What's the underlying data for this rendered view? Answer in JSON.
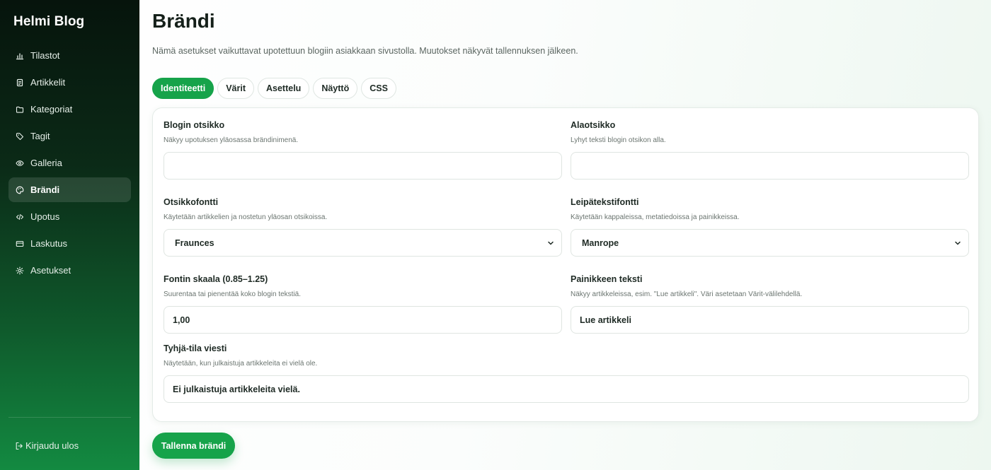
{
  "app": {
    "title": "Helmi Blog"
  },
  "sidebar": {
    "items": [
      {
        "label": "Tilastot",
        "icon": "bar-chart-icon"
      },
      {
        "label": "Artikkelit",
        "icon": "document-icon"
      },
      {
        "label": "Kategoriat",
        "icon": "folder-icon"
      },
      {
        "label": "Tagit",
        "icon": "tag-icon"
      },
      {
        "label": "Galleria",
        "icon": "eye-icon"
      },
      {
        "label": "Brändi",
        "icon": "palette-icon",
        "active": true
      },
      {
        "label": "Upotus",
        "icon": "code-icon"
      },
      {
        "label": "Laskutus",
        "icon": "credit-card-icon"
      },
      {
        "label": "Asetukset",
        "icon": "gear-icon"
      }
    ],
    "logout_label": "Kirjaudu ulos"
  },
  "page": {
    "title": "Brändi",
    "description": "Nämä asetukset vaikuttavat upotettuun blogiin asiakkaan sivustolla. Muutokset näkyvät tallennuksen jälkeen."
  },
  "tabs": [
    {
      "label": "Identiteetti",
      "active": true
    },
    {
      "label": "Värit"
    },
    {
      "label": "Asettelu"
    },
    {
      "label": "Näyttö"
    },
    {
      "label": "CSS"
    }
  ],
  "form": {
    "blog_title": {
      "label": "Blogin otsikko",
      "help": "Näkyy upotuksen yläosassa brändinimenä.",
      "value": ""
    },
    "subtitle": {
      "label": "Alaotsikko",
      "help": "Lyhyt teksti blogin otsikon alla.",
      "value": ""
    },
    "heading_font": {
      "label": "Otsikkofontti",
      "help": "Käytetään artikkelien ja nostetun yläosan otsikoissa.",
      "value": "Fraunces"
    },
    "body_font": {
      "label": "Leipätekstifontti",
      "help": "Käytetään kappaleissa, metatiedoissa ja painikkeissa.",
      "value": "Manrope"
    },
    "font_scale": {
      "label": "Fontin skaala (0.85–1.25)",
      "help": "Suurentaa tai pienentää koko blogin tekstiä.",
      "value": "1,00"
    },
    "button_text": {
      "label": "Painikkeen teksti",
      "help": "Näkyy artikkeleissa, esim. \"Lue artikkeli\". Väri asetetaan Värit-välilehdellä.",
      "value": "Lue artikkeli"
    },
    "empty_message": {
      "label": "Tyhjä-tila viesti",
      "help": "Näytetään, kun julkaistuja artikkeleita ei vielä ole.",
      "value": "Ei julkaistuja artikkeleita vielä."
    }
  },
  "actions": {
    "save_label": "Tallenna brändi"
  },
  "colors": {
    "accent": "#16a34a",
    "sidebar_dark": "#06140c",
    "sidebar_green": "#138a41"
  }
}
